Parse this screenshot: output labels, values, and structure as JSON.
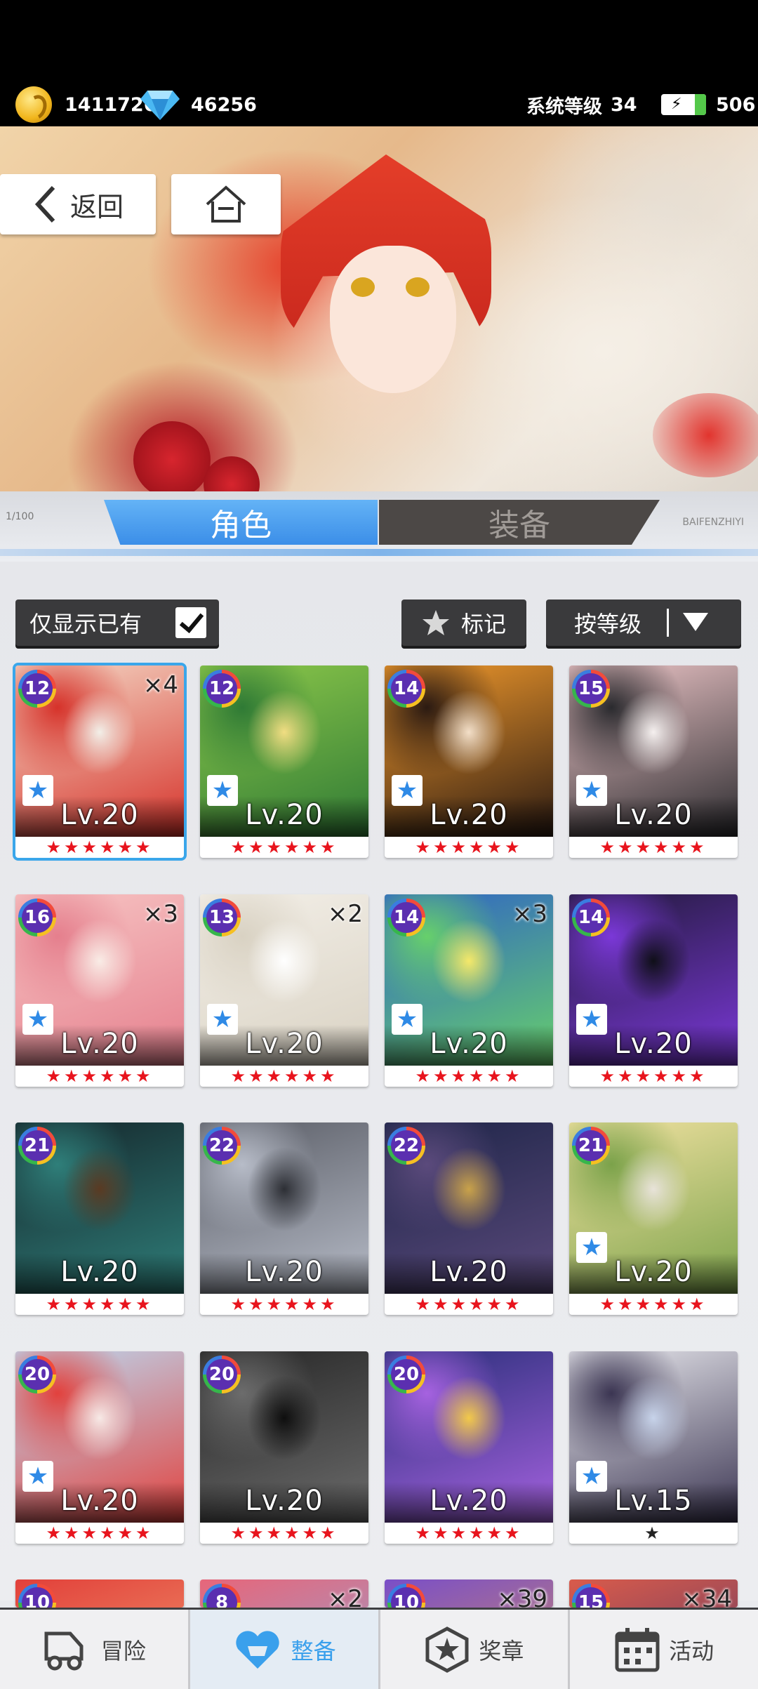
{
  "status": {
    "coins": "1411726",
    "diamonds": "46256",
    "system_level_label": "系统等级",
    "system_level": "34",
    "stamina": "506"
  },
  "nav": {
    "back_label": "返回"
  },
  "tabs": [
    {
      "label": "角色",
      "active": true
    },
    {
      "label": "装备",
      "active": false
    }
  ],
  "tab_deco": {
    "left": "1/100",
    "right": "BAIFENZHIYI"
  },
  "filters": {
    "owned_only_label": "仅显示已有",
    "owned_only_checked": true,
    "mark_label": "标记",
    "sort_label": "按等级"
  },
  "cards": [
    {
      "rank": "12",
      "level": "Lv.20",
      "stars": "★★★★★★",
      "dup": "×4",
      "marked": true,
      "selected": true,
      "palette": [
        "#f4d9c7",
        "#d6322a",
        "#f2efe8"
      ]
    },
    {
      "rank": "12",
      "level": "Lv.20",
      "stars": "★★★★★★",
      "dup": "",
      "marked": true,
      "selected": false,
      "palette": [
        "#8dc84a",
        "#2f7a35",
        "#f1dd82"
      ]
    },
    {
      "rank": "14",
      "level": "Lv.20",
      "stars": "★★★★★★",
      "dup": "",
      "marked": true,
      "selected": false,
      "palette": [
        "#f29a2c",
        "#2b1a12",
        "#f3dfc8"
      ]
    },
    {
      "rank": "15",
      "level": "Lv.20",
      "stars": "★★★★★★",
      "dup": "",
      "marked": true,
      "selected": false,
      "palette": [
        "#efc7c9",
        "#2a2a2e",
        "#f5f0ef"
      ]
    },
    {
      "rank": "16",
      "level": "Lv.20",
      "stars": "★★★★★★",
      "dup": "×3",
      "marked": true,
      "selected": false,
      "palette": [
        "#f7c5c4",
        "#e57f8d",
        "#f9ece6"
      ]
    },
    {
      "rank": "13",
      "level": "Lv.20",
      "stars": "★★★★★★",
      "dup": "×2",
      "marked": true,
      "selected": false,
      "palette": [
        "#f3efe8",
        "#d9d2c3",
        "#ffffff"
      ]
    },
    {
      "rank": "14",
      "level": "Lv.20",
      "stars": "★★★★★★",
      "dup": "×3",
      "marked": true,
      "selected": false,
      "palette": [
        "#2f63c6",
        "#67d06b",
        "#f5e86a"
      ]
    },
    {
      "rank": "14",
      "level": "Lv.20",
      "stars": "★★★★★★",
      "dup": "",
      "marked": true,
      "selected": false,
      "palette": [
        "#221a3b",
        "#7b38d8",
        "#0f0f18"
      ]
    },
    {
      "rank": "21",
      "level": "Lv.20",
      "stars": "★★★★★★",
      "dup": "",
      "marked": false,
      "selected": false,
      "palette": [
        "#15262b",
        "#2f7f7a",
        "#5a3a22"
      ]
    },
    {
      "rank": "22",
      "level": "Lv.20",
      "stars": "★★★★★★",
      "dup": "",
      "marked": false,
      "selected": false,
      "palette": [
        "#5a5d66",
        "#b7bcc8",
        "#2d2f35"
      ]
    },
    {
      "rank": "22",
      "level": "Lv.20",
      "stars": "★★★★★★",
      "dup": "",
      "marked": false,
      "selected": false,
      "palette": [
        "#1e2548",
        "#5b4a7c",
        "#c9a24a"
      ]
    },
    {
      "rank": "21",
      "level": "Lv.20",
      "stars": "★★★★★★",
      "dup": "",
      "marked": true,
      "selected": false,
      "palette": [
        "#f2e2a2",
        "#7ba24a",
        "#e8e3d9"
      ]
    },
    {
      "rank": "20",
      "level": "Lv.20",
      "stars": "★★★★★★",
      "dup": "",
      "marked": true,
      "selected": false,
      "palette": [
        "#bcd8f0",
        "#e2413d",
        "#f7e9e6"
      ]
    },
    {
      "rank": "20",
      "level": "Lv.20",
      "stars": "★★★★★★",
      "dup": "",
      "marked": false,
      "selected": false,
      "palette": [
        "#262626",
        "#6c6c6c",
        "#0e0e0e"
      ]
    },
    {
      "rank": "20",
      "level": "Lv.20",
      "stars": "★★★★★★",
      "dup": "",
      "marked": false,
      "selected": false,
      "palette": [
        "#2a2f7a",
        "#a662e0",
        "#f2c94a"
      ]
    },
    {
      "rank": "",
      "level": "Lv.15",
      "stars": "★",
      "dup": "",
      "marked": true,
      "selected": false,
      "palette": [
        "#e9e9ee",
        "#3b3552",
        "#c7d3ea"
      ]
    }
  ],
  "partial_row": [
    {
      "rank": "10",
      "dup": "",
      "palette": [
        "#e2403a",
        "#f3b07c"
      ]
    },
    {
      "rank": "8",
      "dup": "×2",
      "palette": [
        "#e7667a",
        "#7fb1e8"
      ]
    },
    {
      "rank": "10",
      "dup": "×39",
      "palette": [
        "#7a4fc8",
        "#e69a4a"
      ]
    },
    {
      "rank": "15",
      "dup": "×34",
      "palette": [
        "#d95b4b",
        "#3d2f6b"
      ]
    }
  ],
  "bottom_nav": [
    {
      "label": "冒险",
      "icon": "truck-icon",
      "active": false
    },
    {
      "label": "整备",
      "icon": "heart-bell-icon",
      "active": true
    },
    {
      "label": "奖章",
      "icon": "medal-icon",
      "active": false
    },
    {
      "label": "活动",
      "icon": "calendar-icon",
      "active": false
    }
  ],
  "colors": {
    "accent": "#3aa0ec",
    "star": "#e8141d",
    "tab_active": "#4a9ff0",
    "dark_button": "#3a3a3c"
  }
}
